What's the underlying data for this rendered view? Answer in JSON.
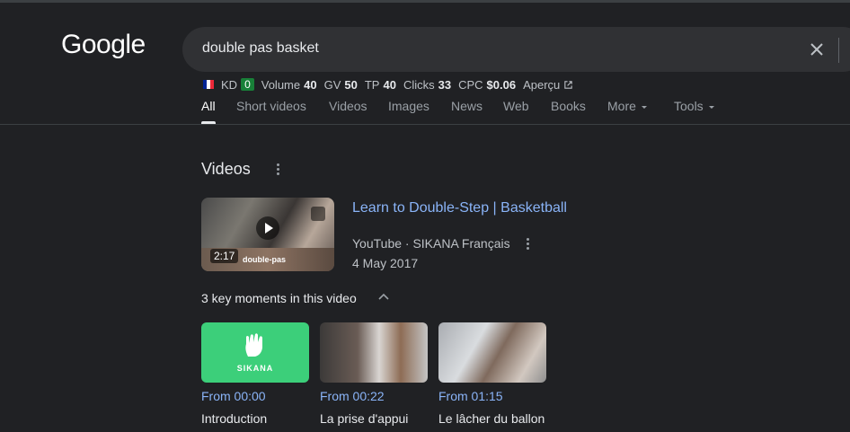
{
  "logo": "Google",
  "search": {
    "query": "double pas basket"
  },
  "seo_bar": {
    "flag_colors": [
      "#002395",
      "#ffffff",
      "#ed2939"
    ],
    "kd_label": "KD",
    "kd_value": "0",
    "volume_label": "Volume",
    "volume_value": "40",
    "gv_label": "GV",
    "gv_value": "50",
    "tp_label": "TP",
    "tp_value": "40",
    "clicks_label": "Clicks",
    "clicks_value": "33",
    "cpc_label": "CPC",
    "cpc_value": "$0.06",
    "apercu_label": "Aperçu"
  },
  "tabs": [
    {
      "label": "All",
      "active": true
    },
    {
      "label": "Short videos"
    },
    {
      "label": "Videos"
    },
    {
      "label": "Images"
    },
    {
      "label": "News"
    },
    {
      "label": "Web"
    },
    {
      "label": "Books"
    },
    {
      "label": "More"
    },
    {
      "label": "Tools"
    }
  ],
  "videos_section": {
    "title": "Videos",
    "video": {
      "title": "Learn to Double-Step | Basketball",
      "source": "YouTube · SIKANA Français",
      "date": "4 May 2017",
      "duration": "2:17",
      "thumb_caption": "double-pas"
    },
    "key_moments_title": "3 key moments in this video",
    "moments": [
      {
        "time": "From 00:00",
        "label": "Introduction",
        "thumb_text": "SIKANA"
      },
      {
        "time": "From 00:22",
        "label": "La prise d'appui"
      },
      {
        "time": "From 01:15",
        "label": "Le lâcher du ballon"
      }
    ]
  },
  "colors": {
    "background": "#202124",
    "link": "#8ab4f8",
    "sikana_green": "#3ccf7a"
  }
}
